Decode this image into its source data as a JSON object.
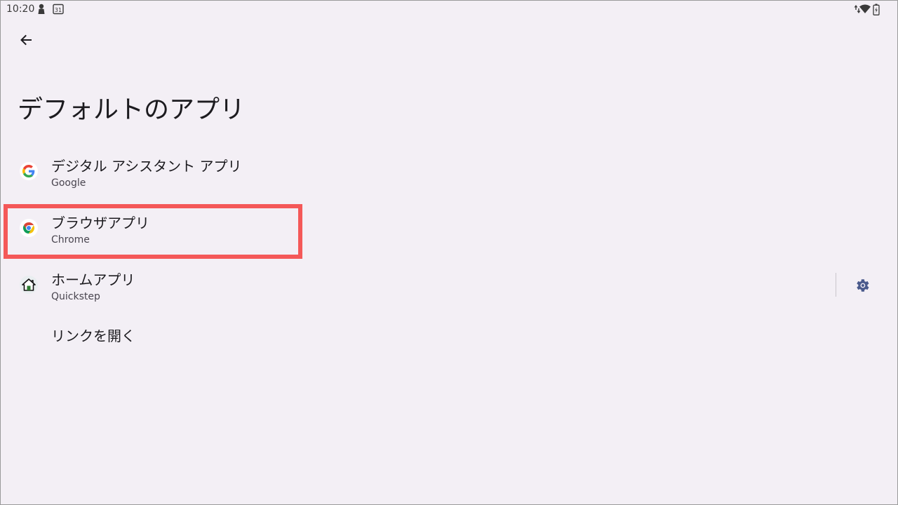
{
  "status_bar": {
    "time": "10:20",
    "calendar_day": "31",
    "icons": [
      "person-icon",
      "calendar-icon",
      "data-arrows-icon",
      "wifi-icon",
      "battery-icon"
    ]
  },
  "nav": {
    "back_icon": "arrow-left-icon"
  },
  "page": {
    "title": "デフォルトのアプリ"
  },
  "items": [
    {
      "title": "デジタル アシスタント アプリ",
      "summary": "Google",
      "icon": "google-icon"
    },
    {
      "title": "ブラウザアプリ",
      "summary": "Chrome",
      "icon": "chrome-icon",
      "highlighted": true
    },
    {
      "title": "ホームアプリ",
      "summary": "Quickstep",
      "icon": "home-icon",
      "has_settings": true
    },
    {
      "title": "リンクを開く"
    }
  ],
  "colors": {
    "background": "#f3eff5",
    "highlight": "#f45858",
    "settings_icon": "#4a5a8c"
  }
}
